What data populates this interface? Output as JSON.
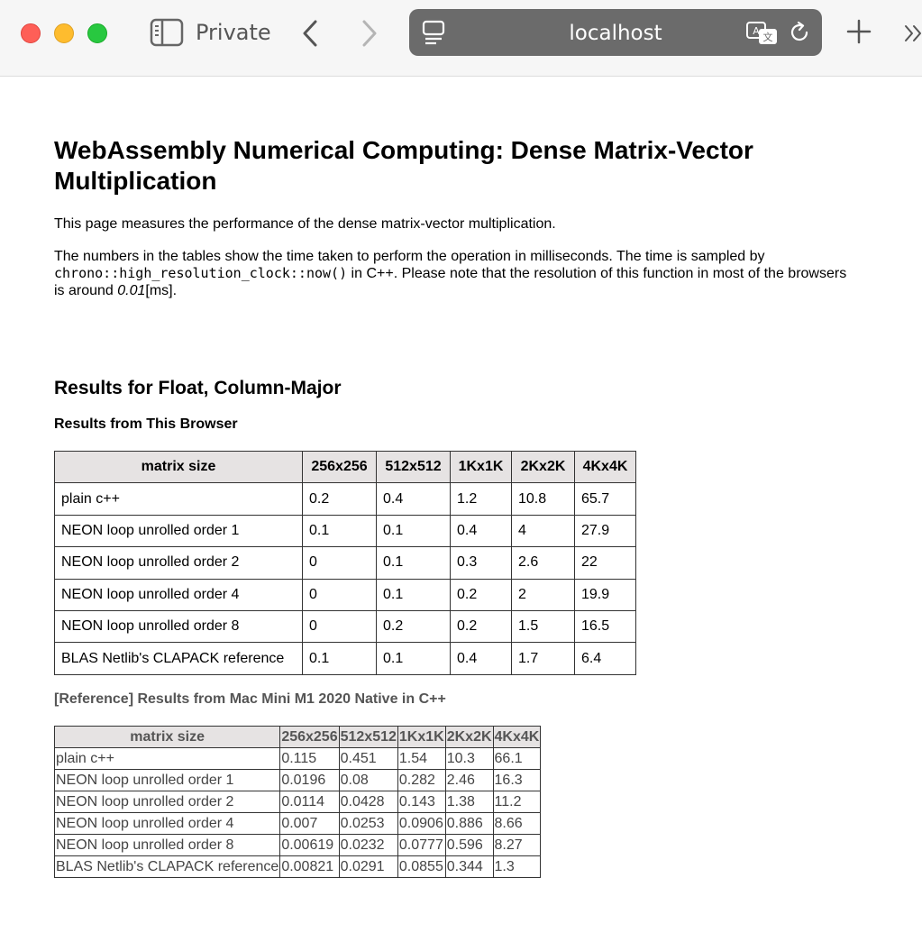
{
  "browser": {
    "private_label": "Private",
    "url": "localhost"
  },
  "page": {
    "title": "WebAssembly Numerical Computing: Dense Matrix-Vector Multiplication",
    "intro": "This page measures the performance of the dense matrix-vector multiplication.",
    "desc_part1": "The numbers in the tables show the time taken to perform the operation in milliseconds. The time is sampled by ",
    "desc_code": "chrono::high_resolution_clock::now()",
    "desc_part2": " in C++. Please note that the resolution of this function in most of the browsers is around ",
    "desc_em": "0.01",
    "desc_part3": "[ms]."
  },
  "section": {
    "heading": "Results for Float, Column-Major",
    "browser_results_heading": "Results from This Browser",
    "reference_heading": "[Reference] Results from Mac Mini M1 2020 Native in C++"
  },
  "table_browser": {
    "headers": [
      "matrix size",
      "256x256",
      "512x512",
      "1Kx1K",
      "2Kx2K",
      "4Kx4K"
    ],
    "rows": [
      [
        "plain c++",
        "0.2",
        "0.4",
        "1.2",
        "10.8",
        "65.7"
      ],
      [
        "NEON loop unrolled order 1",
        "0.1",
        "0.1",
        "0.4",
        "4",
        "27.9"
      ],
      [
        "NEON loop unrolled order 2",
        "0",
        "0.1",
        "0.3",
        "2.6",
        "22"
      ],
      [
        "NEON loop unrolled order 4",
        "0",
        "0.1",
        "0.2",
        "2",
        "19.9"
      ],
      [
        "NEON loop unrolled order 8",
        "0",
        "0.2",
        "0.2",
        "1.5",
        "16.5"
      ],
      [
        "BLAS Netlib's CLAPACK reference",
        "0.1",
        "0.1",
        "0.4",
        "1.7",
        "6.4"
      ]
    ]
  },
  "table_reference": {
    "headers": [
      "matrix size",
      "256x256",
      "512x512",
      "1Kx1K",
      "2Kx2K",
      "4Kx4K"
    ],
    "rows": [
      [
        "plain c++",
        "0.115",
        "0.451",
        "1.54",
        "10.3",
        "66.1"
      ],
      [
        "NEON loop unrolled order 1",
        "0.0196",
        "0.08",
        "0.282",
        "2.46",
        "16.3"
      ],
      [
        "NEON loop unrolled order 2",
        "0.0114",
        "0.0428",
        "0.143",
        "1.38",
        "11.2"
      ],
      [
        "NEON loop unrolled order 4",
        "0.007",
        "0.0253",
        "0.0906",
        "0.886",
        "8.66"
      ],
      [
        "NEON loop unrolled order 8",
        "0.00619",
        "0.0232",
        "0.0777",
        "0.596",
        "8.27"
      ],
      [
        "BLAS Netlib's CLAPACK reference",
        "0.00821",
        "0.0291",
        "0.0855",
        "0.344",
        "1.3"
      ]
    ]
  }
}
